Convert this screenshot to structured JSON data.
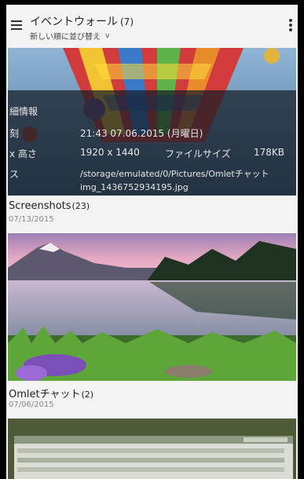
{
  "header": {
    "title": "イベントウォール",
    "count": "(7)",
    "sort_label": "新しい順に並び替え",
    "sort_chevron": "v"
  },
  "icons": {
    "menu": "hamburger-icon",
    "more": "overflow-menu-icon",
    "chevron": "chevron-down-icon"
  },
  "albums": [
    {
      "name": "Screenshots",
      "count": "(23)",
      "date": "07/13/2015",
      "details": {
        "heading": "細情報",
        "time_label": "刻",
        "time_value": "21:43 07.06.2015 (月曜日)",
        "size_label": "x 高さ",
        "size_value": "1920 x 1440",
        "filesize_label": "ファイルサイズ",
        "filesize_value": "178KB",
        "path_label": "ス",
        "path_value": "/storage/emulated/0/Pictures/Omletチャット",
        "path_value2": "img_1436752934195.jpg"
      }
    },
    {
      "name": "Omletチャット",
      "count": "(2)",
      "date": "07/06/2015"
    }
  ],
  "colors": {
    "background": "#f3f3f3",
    "frame": "#000000",
    "text_primary": "#222222",
    "text_secondary": "#888888"
  }
}
